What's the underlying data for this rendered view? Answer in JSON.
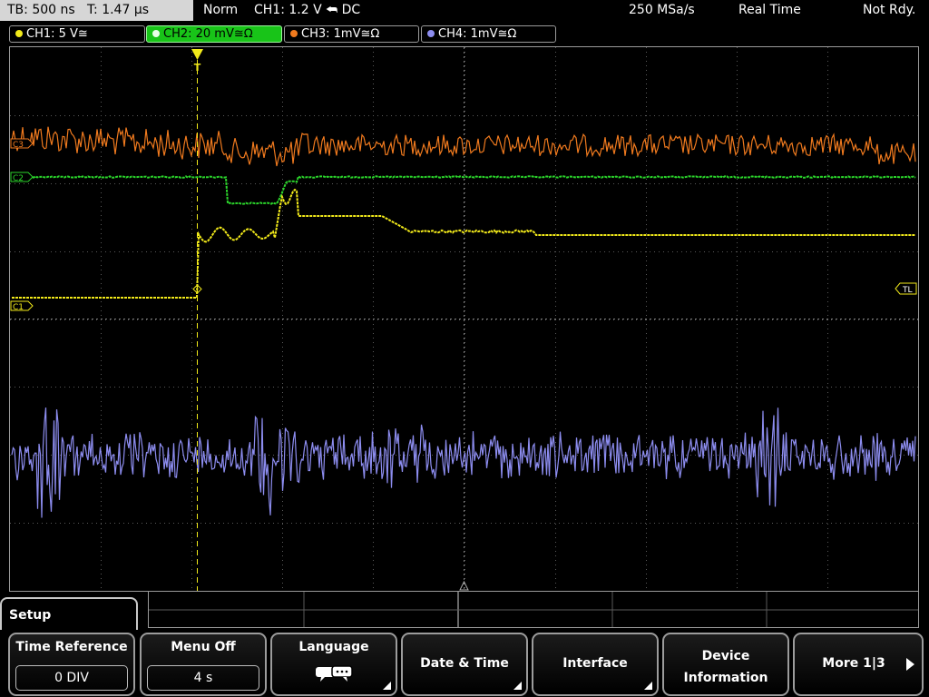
{
  "status": {
    "timebase": "TB: 500 ns   T: 1.47 µs",
    "trigger_mode": "Norm",
    "trigger_info": "CH1: 1.2 V ⮪ DC",
    "sample_rate": "250 MSa/s",
    "acq_mode": "Real Time",
    "ready_state": "Not Rdy."
  },
  "channels": [
    {
      "label": "CH1: 5 V≅",
      "color": "#f2ea1a",
      "active": false
    },
    {
      "label": "CH2: 20 mV≅Ω",
      "color": "#2bd42b",
      "active": true
    },
    {
      "label": "CH3: 1mV≅Ω",
      "color": "#f07a1e",
      "active": false
    },
    {
      "label": "CH4: 1mV≅Ω",
      "color": "#8d8df0",
      "active": false
    }
  ],
  "markers": {
    "ch1": "C1",
    "ch2": "C2",
    "ch3": "C3",
    "trigger_level": "TL"
  },
  "trigger_flag": "T",
  "colors": {
    "ch1": "#f2ea1a",
    "ch2": "#2bd42b",
    "ch3": "#f07a1e",
    "ch4": "#8d8df0",
    "grid": "#5a5a5a",
    "trigger_line": "#f2ea1a"
  },
  "menu": {
    "title": "Setup",
    "softkeys": [
      {
        "label": "Time Reference",
        "value": "0 DIV"
      },
      {
        "label": "Menu Off",
        "value": "4 s"
      },
      {
        "label": "Language",
        "icon": "speech-bubbles-icon"
      },
      {
        "label": "Date & Time"
      },
      {
        "label": "Interface"
      },
      {
        "label": "Device Information",
        "line1": "Device",
        "line2": "Information"
      },
      {
        "label": "More 1|3"
      }
    ]
  }
}
